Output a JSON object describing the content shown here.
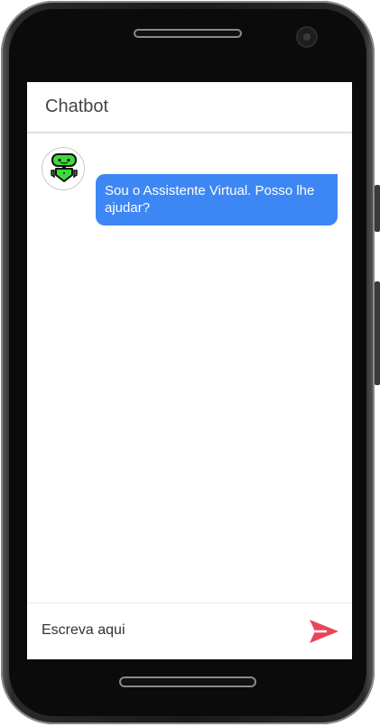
{
  "app": {
    "title": "Chatbot"
  },
  "messages": [
    {
      "sender": "bot",
      "avatar_icon": "robot-icon",
      "text": "Sou o Assistente Virtual. Posso lhe ajudar?"
    }
  ],
  "composer": {
    "placeholder": "Escreva aqui",
    "value": "",
    "send_icon": "send-icon"
  },
  "colors": {
    "bubble": "#3d87f5",
    "send": "#e8455a",
    "robot": "#3ddc3d",
    "header_text": "#444444"
  }
}
